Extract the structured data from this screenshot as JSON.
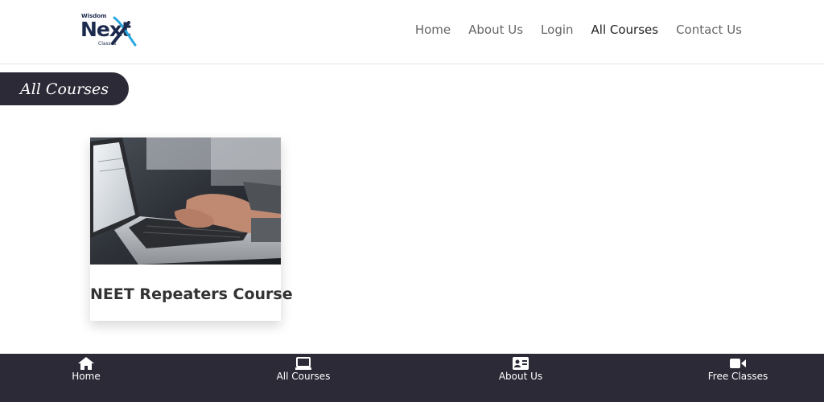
{
  "logo": {
    "top": "Wisdom",
    "main": "Next",
    "bottom": "Classes"
  },
  "nav": {
    "home": "Home",
    "about": "About Us",
    "login": "Login",
    "courses": "All Courses",
    "contact": "Contact Us"
  },
  "page_title": "All Courses",
  "course": {
    "title": "NEET Repeaters Course"
  },
  "bottom_nav": {
    "home": "Home",
    "courses": "All Courses",
    "about": "About Us",
    "free": "Free Classes"
  },
  "colors": {
    "dark": "#2c2a37",
    "brand": "#1c2a4d",
    "accent": "#29a8e0"
  }
}
